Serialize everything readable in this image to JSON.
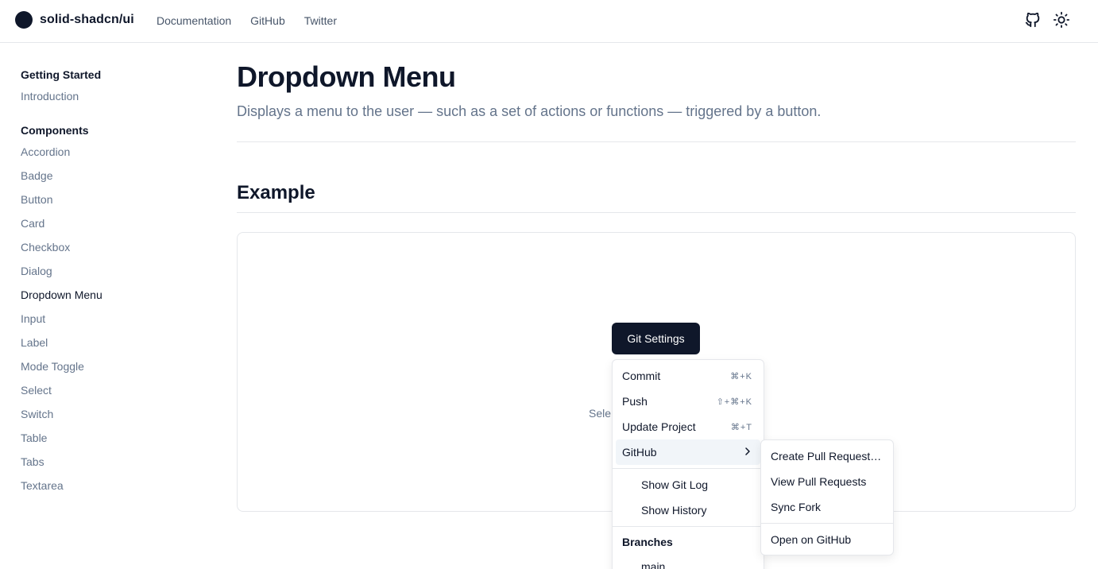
{
  "header": {
    "brand": "solid-shadcn/ui",
    "nav": [
      "Documentation",
      "GitHub",
      "Twitter"
    ],
    "icons": [
      "github-icon",
      "sun-icon"
    ]
  },
  "sidebar": {
    "groups": [
      {
        "heading": "Getting Started",
        "items": [
          "Introduction"
        ]
      },
      {
        "heading": "Components",
        "items": [
          "Accordion",
          "Badge",
          "Button",
          "Card",
          "Checkbox",
          "Dialog",
          "Dropdown Menu",
          "Input",
          "Label",
          "Mode Toggle",
          "Select",
          "Switch",
          "Table",
          "Tabs",
          "Textarea"
        ]
      }
    ],
    "active": "Dropdown Menu"
  },
  "main": {
    "title": "Dropdown Menu",
    "subtitle": "Displays a menu to the user — such as a set of actions or functions — triggered by a button.",
    "section_title": "Example",
    "selected_text_partial": "Sele",
    "button_label": "Git Settings"
  },
  "dropdown": {
    "items": [
      {
        "label": "Commit",
        "shortcut": "⌘+K"
      },
      {
        "label": "Push",
        "shortcut": "⇧+⌘+K"
      },
      {
        "label": "Update Project",
        "shortcut": "⌘+T"
      },
      {
        "label": "GitHub",
        "submenu": true
      }
    ],
    "radio_items": [
      "Show Git Log",
      "Show History"
    ],
    "branches_label": "Branches",
    "branches": [
      "main"
    ]
  },
  "submenu": {
    "items": [
      "Create Pull Request…",
      "View Pull Requests",
      "Sync Fork"
    ],
    "footer_item": "Open on GitHub"
  },
  "colors": {
    "primary": "#0f172a",
    "muted": "#64748b",
    "border": "#e5e7eb",
    "highlight": "#f1f5f9"
  }
}
